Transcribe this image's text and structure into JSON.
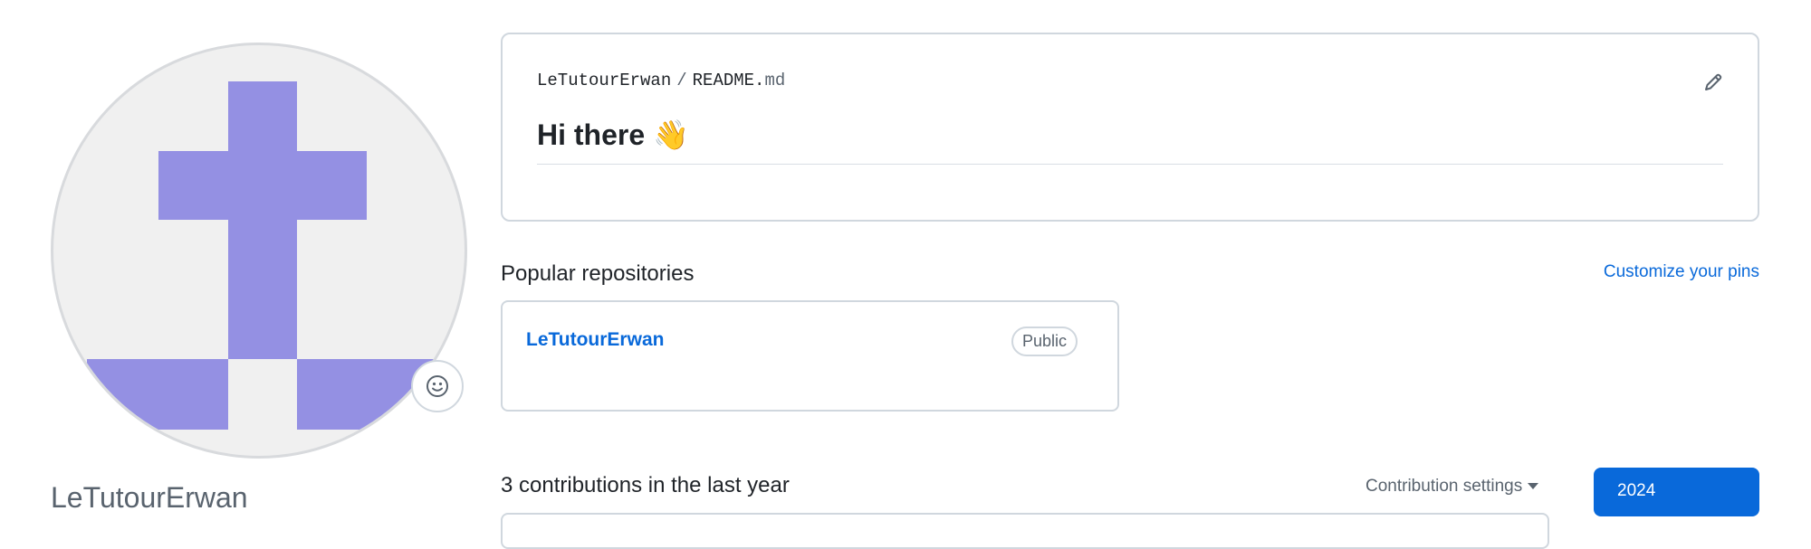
{
  "profile": {
    "username": "LeTutourErwan",
    "avatar_color": "#9490e3",
    "avatar_bg": "#f0f0f0",
    "status_icon": "smiley-icon"
  },
  "readme": {
    "owner": "LeTutourErwan",
    "separator": "/",
    "file_base": "README.",
    "file_ext": "md",
    "heading": "Hi there 👋",
    "edit_icon": "pencil-icon"
  },
  "pinned": {
    "title": "Popular repositories",
    "customize_label": "Customize your pins",
    "repos": [
      {
        "name": "LeTutourErwan",
        "visibility": "Public"
      }
    ]
  },
  "contributions": {
    "title": "3 contributions in the last year",
    "settings_label": "Contribution settings",
    "year": "2024"
  },
  "colors": {
    "link": "#0969da",
    "border": "#d0d7de",
    "primary_button": "#0969da"
  }
}
